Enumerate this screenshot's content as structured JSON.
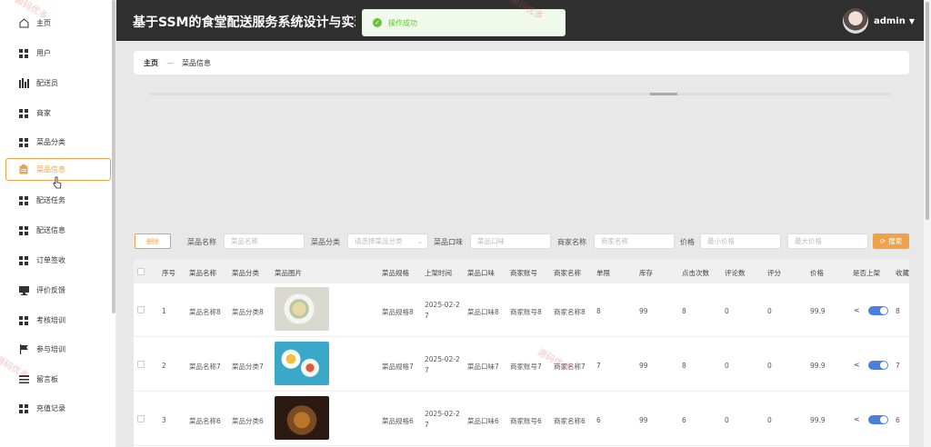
{
  "sidebar": {
    "items": [
      {
        "label": "主页",
        "icon": "home-icon"
      },
      {
        "label": "用户",
        "icon": "grid-icon"
      },
      {
        "label": "配送员",
        "icon": "bar-chart-icon"
      },
      {
        "label": "商家",
        "icon": "grid-icon"
      },
      {
        "label": "菜品分类",
        "icon": "grid-icon"
      },
      {
        "label": "菜品信息",
        "icon": "clipboard-icon",
        "active": true
      },
      {
        "label": "配送任务",
        "icon": "grid-icon"
      },
      {
        "label": "配送信息",
        "icon": "grid-icon"
      },
      {
        "label": "订单签收",
        "icon": "grid-icon"
      },
      {
        "label": "评价反馈",
        "icon": "monitor-icon"
      },
      {
        "label": "考核培训",
        "icon": "grid-icon"
      },
      {
        "label": "参与培训",
        "icon": "flag-icon"
      },
      {
        "label": "留言板",
        "icon": "list-icon"
      },
      {
        "label": "充值记录",
        "icon": "grid-icon"
      }
    ]
  },
  "header": {
    "title": "基于SSM的食堂配送服务系统设计与实现",
    "toast": "操作成功",
    "username": "admin"
  },
  "breadcrumb": {
    "home": "主页",
    "separator": "—",
    "current": "菜品信息"
  },
  "search": {
    "delete_label": "删除",
    "fields": [
      {
        "label": "菜品名称",
        "placeholder": "菜品名称"
      },
      {
        "label": "菜品分类",
        "placeholder": "请选择菜品分类"
      },
      {
        "label": "菜品口味",
        "placeholder": "菜品口味"
      },
      {
        "label": "商家名称",
        "placeholder": "商家名称"
      },
      {
        "label": "价格",
        "placeholder": "最小价格"
      },
      {
        "label": "",
        "placeholder": "最大价格"
      }
    ],
    "search_label": "搜索"
  },
  "table": {
    "columns": [
      "序号",
      "菜品名称",
      "菜品分类",
      "菜品图片",
      "菜品规格",
      "上架时间",
      "菜品口味",
      "商家账号",
      "商家名称",
      "单限",
      "库存",
      "点击次数",
      "评论数",
      "评分",
      "价格",
      "是否上架",
      "收藏"
    ],
    "rows": [
      {
        "idx": "1",
        "name": "菜品名称8",
        "cat": "菜品分类8",
        "spec": "菜品规格8",
        "time1": "2025-02-2",
        "time2": "7",
        "taste": "菜品口味8",
        "acct": "商家账号8",
        "shop": "商家名称8",
        "limit": "8",
        "stock": "99",
        "clicks": "8",
        "comments": "0",
        "score": "0",
        "price": "99.9",
        "fav": "8",
        "on_sale": true
      },
      {
        "idx": "2",
        "name": "菜品名称7",
        "cat": "菜品分类7",
        "spec": "菜品规格7",
        "time1": "2025-02-2",
        "time2": "7",
        "taste": "菜品口味7",
        "acct": "商家账号7",
        "shop": "商家名称7",
        "limit": "7",
        "stock": "99",
        "clicks": "8",
        "comments": "0",
        "score": "0",
        "price": "99.9",
        "fav": "7",
        "on_sale": true
      },
      {
        "idx": "3",
        "name": "菜品名称6",
        "cat": "菜品分类6",
        "spec": "菜品规格6",
        "time1": "2025-02-2",
        "time2": "7",
        "taste": "菜品口味6",
        "acct": "商家账号6",
        "shop": "商家名称6",
        "limit": "6",
        "stock": "99",
        "clicks": "6",
        "comments": "0",
        "score": "0",
        "price": "99.9",
        "fav": "6",
        "on_sale": true
      }
    ]
  },
  "watermarks": [
    "源码优多",
    "源码优多",
    "源码优多",
    "源码优多"
  ],
  "colors": {
    "accent": "#f0a24b",
    "header_bg": "#2f2f2f",
    "toggle_on": "#4a7fe0",
    "success": "#67c23a"
  }
}
